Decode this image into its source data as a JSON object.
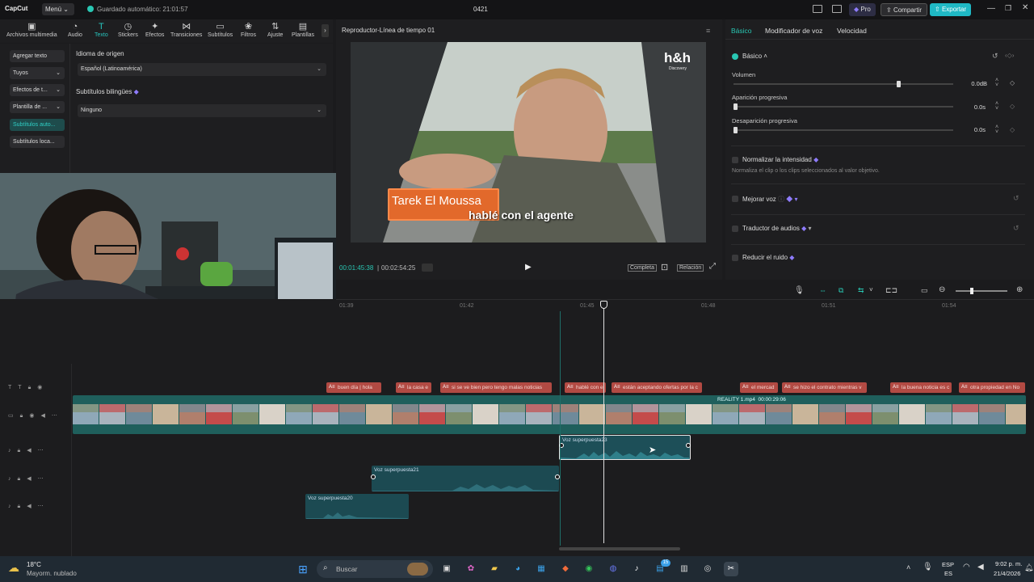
{
  "app": {
    "logo": "CapCut",
    "menu_label": "Menú",
    "autosave": "Guardado automático: 21:01:57",
    "project_name": "0421",
    "pro_label": "Pro",
    "share_label": "Compartir",
    "export_label": "Exportar"
  },
  "toolbar": {
    "items": [
      {
        "label": "Archivos multimedia",
        "icon": "media-icon"
      },
      {
        "label": "Audio",
        "icon": "audio-icon"
      },
      {
        "label": "Texto",
        "icon": "text-icon"
      },
      {
        "label": "Stickers",
        "icon": "sticker-icon"
      },
      {
        "label": "Efectos",
        "icon": "effects-icon"
      },
      {
        "label": "Transiciones",
        "icon": "transitions-icon"
      },
      {
        "label": "Subtítulos",
        "icon": "captions-icon"
      },
      {
        "label": "Filtros",
        "icon": "filters-icon"
      },
      {
        "label": "Ajuste",
        "icon": "adjust-icon"
      },
      {
        "label": "Plantillas",
        "icon": "templates-icon"
      }
    ]
  },
  "leftnav": {
    "items": [
      "Agregar texto",
      "Tuyos",
      "Efectos de t...",
      "Plantilla de ...",
      "Subtítulos auto...",
      "Subtítulos loca..."
    ]
  },
  "captions_panel": {
    "source_language_label": "Idioma de origen",
    "source_language_value": "Español (Latinoamérica)",
    "bilingual_label": "Subtítulos bilingües",
    "bilingual_value": "Ninguno"
  },
  "player": {
    "title": "Reproductor-Línea de tiempo 01",
    "watermark": "h&h",
    "watermark_sub": "Discovery",
    "caption_name": "Tarek El Moussa",
    "caption_line": "hablé con el agente",
    "current_time": "00:01:45:38",
    "total_time": "00:02:54:25",
    "full_label": "Completa",
    "ratio_label": "Relación"
  },
  "right_panel": {
    "tabs": [
      "Básico",
      "Modificador de voz",
      "Velocidad"
    ],
    "section_basic": "Básico",
    "volume_label": "Volumen",
    "volume_value": "0.0dB",
    "volume_level": 0.75,
    "fade_in_label": "Aparición progresiva",
    "fade_in_value": "0.0s",
    "fade_out_label": "Desaparición progresiva",
    "fade_out_value": "0.0s",
    "normalize_label": "Normalizar la intensidad",
    "normalize_desc": "Normaliza el clip o los clips seleccionados al valor objetivo.",
    "enhance_voice_label": "Mejorar voz",
    "translator_label": "Traductor de audios",
    "reduce_noise_label": "Reducir el ruido"
  },
  "timeline": {
    "ruler": [
      "01:39",
      "01:42",
      "01:45",
      "01:48",
      "01:51",
      "01:54"
    ],
    "subtitles": [
      "buen día | hola",
      "la casa e",
      "si se ve bien pero tengo malas noticias",
      "hablé con el",
      "están aceptando ofertas por la c",
      "el mercad",
      "se hizo el contrato mientras v",
      "la buena noticia es c",
      "otra propiedad en No"
    ],
    "video_clip_label": "REALITY 1.mp4",
    "video_clip_duration": "00:00:29:06",
    "audio_clips": [
      "Voz superpuesta23",
      "Voz superpuesta21",
      "Voz superpuesta20"
    ]
  },
  "taskbar": {
    "weather_temp": "18°C",
    "weather_desc": "Mayorm. nublado",
    "search_placeholder": "Buscar",
    "lang_top": "ESP",
    "lang_bottom": "ES",
    "time": "9:02 p. m.",
    "date": "21/4/2026",
    "badge_count": "15"
  },
  "colors": {
    "accent": "#29c7b3",
    "subtitle_clip": "#b24a43",
    "video_track": "#1f5f5c",
    "audio_clip": "#1c4a52",
    "export": "#1fb8c4"
  }
}
